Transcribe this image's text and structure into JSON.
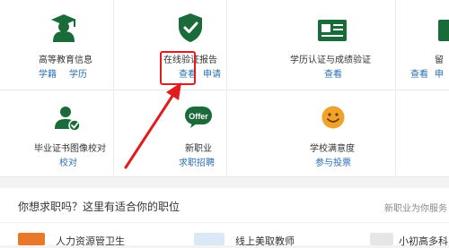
{
  "services": {
    "higher_edu_info": {
      "title": "高等教育信息",
      "links": [
        "学籍",
        "学历"
      ]
    },
    "online_verification_report": {
      "title": "在线验证报告",
      "links": [
        "查看",
        "申请"
      ]
    },
    "degree_cert_verify": {
      "title": "学历认证与成绩验证",
      "links": [
        "查看"
      ]
    },
    "partial_right": {
      "title": "留",
      "links": [
        "查看",
        "申"
      ]
    },
    "diploma_photo_check": {
      "title": "毕业证书图像校对",
      "links": [
        "校对"
      ]
    },
    "new_career": {
      "title": "新职业",
      "badge": "Offer",
      "links": [
        "求职招聘"
      ]
    },
    "school_satisfaction": {
      "title": "学校满意度",
      "links": [
        "参与投票"
      ]
    }
  },
  "jobs": {
    "heading": "你想求职吗？这里有适合你的职位",
    "help": "新职业为你服务",
    "previews": [
      "人力资源管卫生",
      "线上美取教师",
      "小初高多科"
    ]
  },
  "colors": {
    "icon_green": "#1b6b3a",
    "link_blue": "#2a6fb3",
    "smiley_orange": "#f1a22a",
    "highlight_red": "#e21c1c"
  }
}
